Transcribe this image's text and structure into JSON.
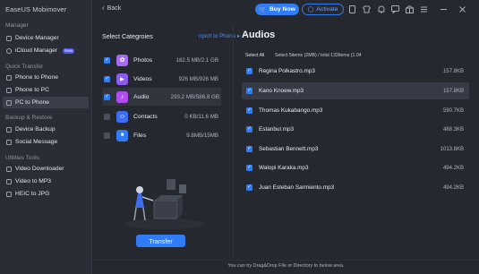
{
  "app": {
    "brand": "EaseUS Mobimover"
  },
  "sidebar": {
    "sections": [
      {
        "title": "Manager",
        "items": [
          {
            "label": "Device Manager",
            "icon": "device-icon"
          },
          {
            "label": "iCloud Manager",
            "icon": "cloud-icon",
            "badge": "New"
          }
        ]
      },
      {
        "title": "Quick Transfer",
        "items": [
          {
            "label": "Phone to Phone",
            "icon": "phone-icon"
          },
          {
            "label": "Phone to PC",
            "icon": "phone-pc-icon"
          },
          {
            "label": "PC to Phone",
            "icon": "pc-phone-icon",
            "active": true
          }
        ]
      },
      {
        "title": "Backup & Restore",
        "items": [
          {
            "label": "Device Backup",
            "icon": "backup-icon"
          },
          {
            "label": "Social Message",
            "icon": "message-icon"
          }
        ]
      },
      {
        "title": "Utilities Tools",
        "items": [
          {
            "label": "Video Downloader",
            "icon": "download-icon"
          },
          {
            "label": "Video to MP3",
            "icon": "mp3-icon"
          },
          {
            "label": "HEIC to JPG",
            "icon": "image-icon"
          }
        ]
      }
    ]
  },
  "toolbar": {
    "back_label": "Back",
    "buy_label": "Buy Now",
    "activate_label": "Activate",
    "icons": [
      "phone-icon",
      "shirt-icon",
      "bell-icon",
      "feedback-icon",
      "gift-icon",
      "menu-icon",
      "minimize-icon",
      "close-icon"
    ]
  },
  "categories": {
    "title": "Select Categroies",
    "link": "nport to Phone ▸",
    "items": [
      {
        "name": "Photos",
        "size": "182.5 MB/2.1 GB",
        "checked": true,
        "color": "#a66bf4",
        "glyph": "✿"
      },
      {
        "name": "Videos",
        "size": "926 MB/926 MB",
        "checked": true,
        "color": "#8c5cf0",
        "glyph": "▶"
      },
      {
        "name": "Audio",
        "size": "293.2 MB/586.8 GB",
        "checked": true,
        "color": "#b04cf0",
        "glyph": "♪",
        "active": true
      },
      {
        "name": "Contacts",
        "size": "0 KB/11.6 MB",
        "checked": false,
        "color": "#3d6ff0",
        "glyph": "☺"
      },
      {
        "name": "Files",
        "size": "9.8MB/15MB",
        "checked": false,
        "color": "#2f7cf6",
        "glyph": "■"
      }
    ],
    "transfer_label": "Transfer"
  },
  "audio": {
    "title": "Audios",
    "select_all": "Select All",
    "summary": "Select 5items (2MB) / total 132items (1.04",
    "files": [
      {
        "name": "Regina Polkastro.mp3",
        "size": "157.8KB"
      },
      {
        "name": "Kano Knoew.mp3",
        "size": "157.8KB",
        "highlight": true
      },
      {
        "name": "Thomas Kukabango.mp3",
        "size": "590.7KB"
      },
      {
        "name": "Estanbul.mp3",
        "size": "488.3KB"
      },
      {
        "name": "Sebastian Bennett.mp3",
        "size": "1013.8KB"
      },
      {
        "name": "Walopi Karaka.mp3",
        "size": "494.2KB"
      },
      {
        "name": "Juan Esteban Sarmiento.mp3",
        "size": "494.2KB"
      }
    ]
  },
  "footer": {
    "text": "You can try Drag&Drop File or Directory to below area."
  },
  "colors": {
    "accent": "#2f7cf6",
    "bg": "#25282f",
    "sidebar": "#2a2d35"
  }
}
